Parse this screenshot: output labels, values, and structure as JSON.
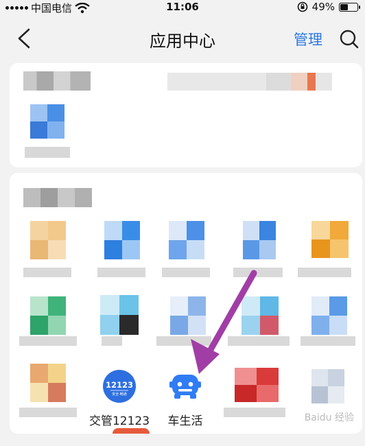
{
  "status_bar": {
    "carrier": "中国电信",
    "time": "11:06",
    "battery": "49%",
    "battery_level": 0.49
  },
  "header": {
    "title": "应用中心",
    "manage_label": "管理",
    "back_icon": "chevron-left-icon",
    "search_icon": "search-icon"
  },
  "apps": [
    {
      "label": "交管12123",
      "icon": "jiaoguan-12123-icon",
      "icon_text": "12123",
      "icon_subtext": "安全·畅通",
      "color": "#2d6fe0"
    },
    {
      "label": "车生活",
      "icon": "car-life-icon",
      "color": "#2f7cf6"
    }
  ],
  "watermark": "Baidu 经验",
  "colors": {
    "accent": "#2b78e4",
    "arrow": "#a13ea6"
  }
}
